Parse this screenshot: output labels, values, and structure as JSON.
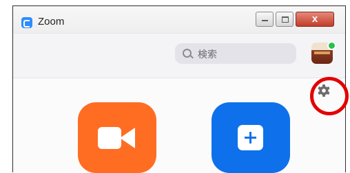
{
  "window": {
    "title": "Zoom",
    "close_glyph": "x"
  },
  "search": {
    "placeholder": "検索",
    "icon": "search-icon"
  },
  "profile": {
    "avatar": "avatar",
    "status": "online"
  },
  "settings": {
    "icon": "gear-icon",
    "highlighted": true
  },
  "home": {
    "tiles": [
      {
        "id": "new-meeting",
        "icon": "video-camera-icon",
        "color": "#ff6d22"
      },
      {
        "id": "join",
        "icon": "plus-icon",
        "color": "#0e71eb"
      }
    ]
  },
  "colors": {
    "highlight": "#e40000",
    "status_online": "#27c24c"
  }
}
